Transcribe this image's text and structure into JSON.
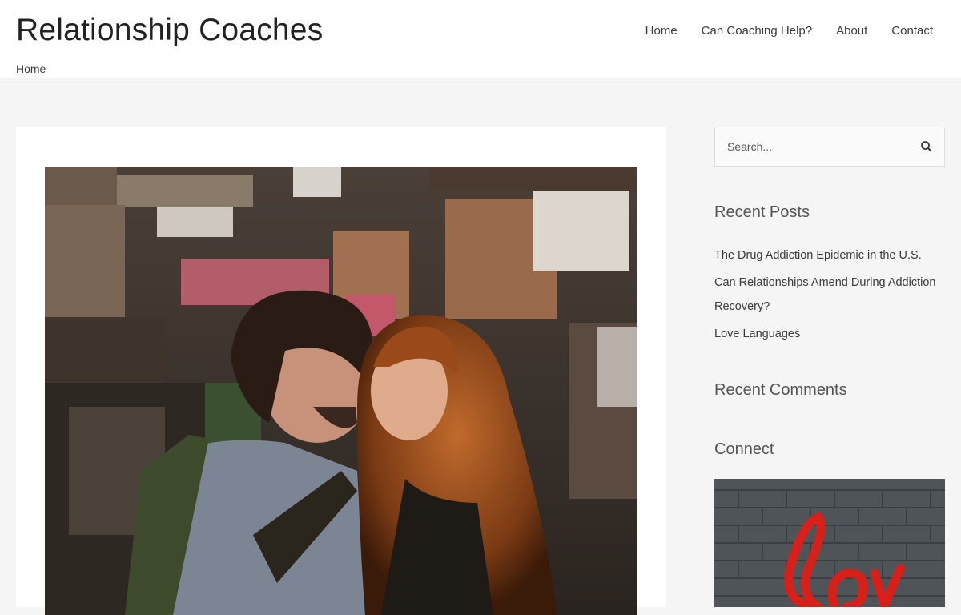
{
  "site": {
    "title": "Relationship Coaches"
  },
  "nav": [
    {
      "label": "Home"
    },
    {
      "label": "Can Coaching Help?"
    },
    {
      "label": "About"
    },
    {
      "label": "Contact"
    }
  ],
  "breadcrumb": "Home",
  "search": {
    "placeholder": "Search..."
  },
  "sidebar": {
    "recent_posts_title": "Recent Posts",
    "recent_posts": [
      "The Drug Addiction Epidemic in the U.S.",
      "Can Relationships Amend During Addiction Recovery?",
      "Love Languages"
    ],
    "recent_comments_title": "Recent Comments",
    "connect_title": "Connect"
  },
  "colors": {
    "header_bg": "#ffffff",
    "page_bg": "#f5f5f5",
    "text": "#3a3a3a",
    "love_red": "#d8201a"
  }
}
